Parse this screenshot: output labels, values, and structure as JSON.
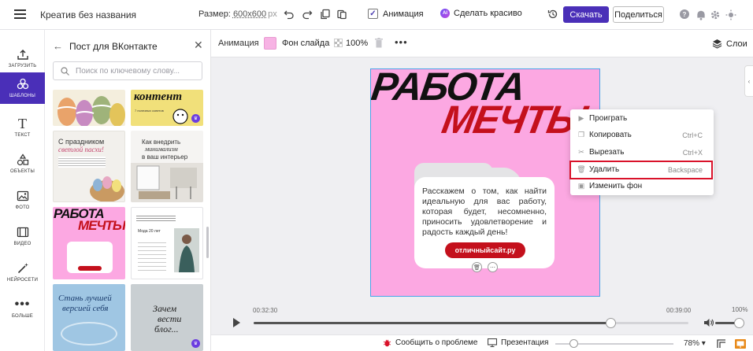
{
  "header": {
    "doc_title": "Креатив без названия",
    "size_label": "Размер:",
    "size_value": "600x600",
    "size_unit": "px",
    "animation_label": "Анимация",
    "animation_checked": true,
    "beautify_label": "Сделать красиво",
    "beautify_badge": "AI",
    "download_label": "Скачать",
    "share_label": "Поделиться",
    "icons": [
      "undo-icon",
      "redo-icon",
      "copy-icon",
      "paste-icon",
      "history-icon",
      "help-icon",
      "settings-icon",
      "sun-icon"
    ],
    "accent_color": "#4a2fb8"
  },
  "rail": {
    "items": [
      {
        "label": "ЗАГРУЗИТЬ",
        "icon": "upload-icon"
      },
      {
        "label": "ШАБЛОНЫ",
        "icon": "templates-icon",
        "active": true
      },
      {
        "label": "ТЕКСТ",
        "icon": "text-icon"
      },
      {
        "label": "ОБЪЕКТЫ",
        "icon": "shapes-icon"
      },
      {
        "label": "ФОТО",
        "icon": "photo-icon"
      },
      {
        "label": "ВИДЕО",
        "icon": "video-icon"
      },
      {
        "label": "НЕЙРОСЕТИ",
        "icon": "magic-wand-icon"
      },
      {
        "label": "БОЛЬШЕ",
        "icon": "more-dots-icon"
      }
    ]
  },
  "panel": {
    "title": "Пост для ВКонтакте",
    "search_placeholder": "Поиск по ключевому слову...",
    "templates": [
      {
        "title": "",
        "type": "easter-eggs"
      },
      {
        "title": "контент",
        "sub": "7 полезных советов",
        "type": "content",
        "premium": true
      },
      {
        "title": "С праздником",
        "title2": "светлой пасхи!",
        "type": "easter-greeting"
      },
      {
        "title": "Как внедрить",
        "title2": "минимализм",
        "title3": "в ваш интерьер",
        "type": "interior"
      },
      {
        "title": "РАБОТА",
        "title2": "МЕЧТЫ",
        "type": "dream-job"
      },
      {
        "title": "Мода 20 лет",
        "type": "fashion"
      },
      {
        "title": "Стань лучшей",
        "title2": "версией себя",
        "type": "better-self"
      },
      {
        "title": "Зачем",
        "title2": "вести",
        "title3": "блог...",
        "type": "blog",
        "premium": true
      }
    ]
  },
  "canvas_toolbar": {
    "animation_label": "Анимация",
    "bg_label": "Фон слайда",
    "bg_color": "#f7b3e4",
    "opacity": "100%",
    "layers_label": "Слои"
  },
  "slide": {
    "title1": "РАБОТА",
    "title2": "МЕЧТЫ",
    "body": "Расскажем о том, как найти идеальную для вас работу, которая будет, несомненно, приносить удовлетворение и радость каждый день!",
    "button": "отличныйсайт.ру",
    "bg_color": "#fca8e2",
    "accent_red": "#c4101c"
  },
  "context_menu": {
    "items": [
      {
        "label": "Проиграть",
        "shortcut": "",
        "icon": "play-icon"
      },
      {
        "label": "Копировать",
        "shortcut": "Ctrl+C",
        "icon": "copy-icon"
      },
      {
        "label": "Вырезать",
        "shortcut": "Ctrl+X",
        "icon": "scissors-icon"
      },
      {
        "label": "Удалить",
        "shortcut": "Backspace",
        "icon": "trash-icon",
        "highlighted": true
      },
      {
        "label": "Изменить фон",
        "shortcut": "",
        "icon": "image-icon"
      }
    ]
  },
  "timeline": {
    "start_time": "00:32:30",
    "end_time": "00:39:00",
    "progress": 0.82,
    "volume_pct": "100%"
  },
  "bottom": {
    "report_label": "Сообщить о проблеме",
    "present_label": "Презентация",
    "zoom": "78%",
    "zoom_level": 0.15
  }
}
